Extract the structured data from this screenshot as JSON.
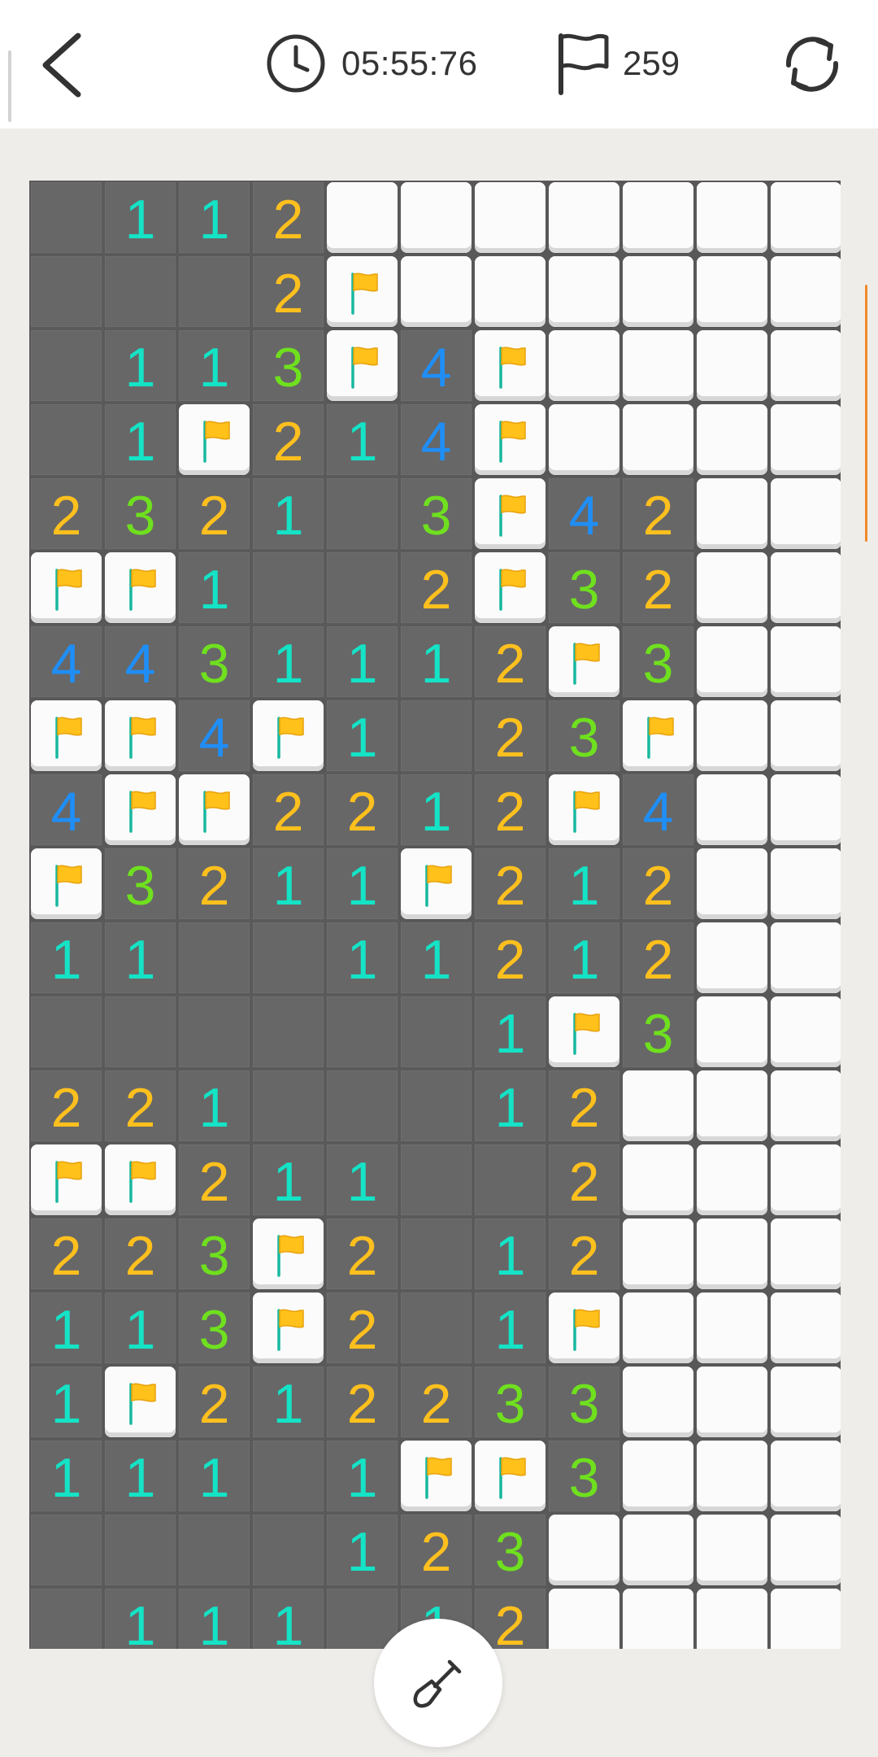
{
  "header": {
    "timer": "05:55:76",
    "flag_count": "259",
    "icons": [
      "chevron-left-icon",
      "clock-icon",
      "flag-outline-icon",
      "refresh-icon"
    ]
  },
  "board": {
    "columns": 11,
    "rows_visible": 20,
    "legend": "O = opened empty, C = unopened, F = flagged, digits = mine count",
    "number_colors": {
      "1": "#14e3c6",
      "2": "#ffc01e",
      "3": "#6fe01e",
      "4": "#1f8ef6"
    },
    "rows": [
      [
        "O",
        "1",
        "1",
        "2",
        "C",
        "C",
        "C",
        "C",
        "C",
        "C",
        "C"
      ],
      [
        "O",
        "O",
        "O",
        "2",
        "F",
        "C",
        "C",
        "C",
        "C",
        "C",
        "C"
      ],
      [
        "O",
        "1",
        "1",
        "3",
        "F",
        "4",
        "F",
        "C",
        "C",
        "C",
        "C"
      ],
      [
        "O",
        "1",
        "F",
        "2",
        "1",
        "4",
        "F",
        "C",
        "C",
        "C",
        "C"
      ],
      [
        "2",
        "3",
        "2",
        "1",
        "O",
        "3",
        "F",
        "4",
        "2",
        "C",
        "C"
      ],
      [
        "F",
        "F",
        "1",
        "O",
        "O",
        "2",
        "F",
        "3",
        "2",
        "C",
        "C"
      ],
      [
        "4",
        "4",
        "3",
        "1",
        "1",
        "1",
        "2",
        "F",
        "3",
        "C",
        "C"
      ],
      [
        "F",
        "F",
        "4",
        "F",
        "1",
        "O",
        "2",
        "3",
        "F",
        "C",
        "C"
      ],
      [
        "4",
        "F",
        "F",
        "2",
        "2",
        "1",
        "2",
        "F",
        "4",
        "C",
        "C"
      ],
      [
        "F",
        "3",
        "2",
        "1",
        "1",
        "F",
        "2",
        "1",
        "2",
        "C",
        "C"
      ],
      [
        "1",
        "1",
        "O",
        "O",
        "1",
        "1",
        "2",
        "1",
        "2",
        "C",
        "C"
      ],
      [
        "O",
        "O",
        "O",
        "O",
        "O",
        "O",
        "1",
        "F",
        "3",
        "C",
        "C"
      ],
      [
        "2",
        "2",
        "1",
        "O",
        "O",
        "O",
        "1",
        "2",
        "C",
        "C",
        "C"
      ],
      [
        "F",
        "F",
        "2",
        "1",
        "1",
        "O",
        "O",
        "2",
        "C",
        "C",
        "C"
      ],
      [
        "2",
        "2",
        "3",
        "F",
        "2",
        "O",
        "1",
        "2",
        "C",
        "C",
        "C"
      ],
      [
        "1",
        "1",
        "3",
        "F",
        "2",
        "O",
        "1",
        "F",
        "C",
        "C",
        "C"
      ],
      [
        "1",
        "F",
        "2",
        "1",
        "2",
        "2",
        "3",
        "3",
        "C",
        "C",
        "C"
      ],
      [
        "1",
        "1",
        "1",
        "O",
        "1",
        "F",
        "F",
        "3",
        "C",
        "C",
        "C"
      ],
      [
        "O",
        "O",
        "O",
        "O",
        "1",
        "2",
        "3",
        "C",
        "C",
        "C",
        "C"
      ],
      [
        "O",
        "1",
        "1",
        "1",
        "O",
        "1",
        "2",
        "C",
        "C",
        "C",
        "C"
      ]
    ]
  },
  "colors": {
    "accent_flag": "#ffc11a",
    "scroll_indicator": "#f08a2a",
    "board_bg": "#585858",
    "opened_cell": "#676767"
  },
  "actions": {
    "dig_mode_icon": "shovel-icon"
  }
}
